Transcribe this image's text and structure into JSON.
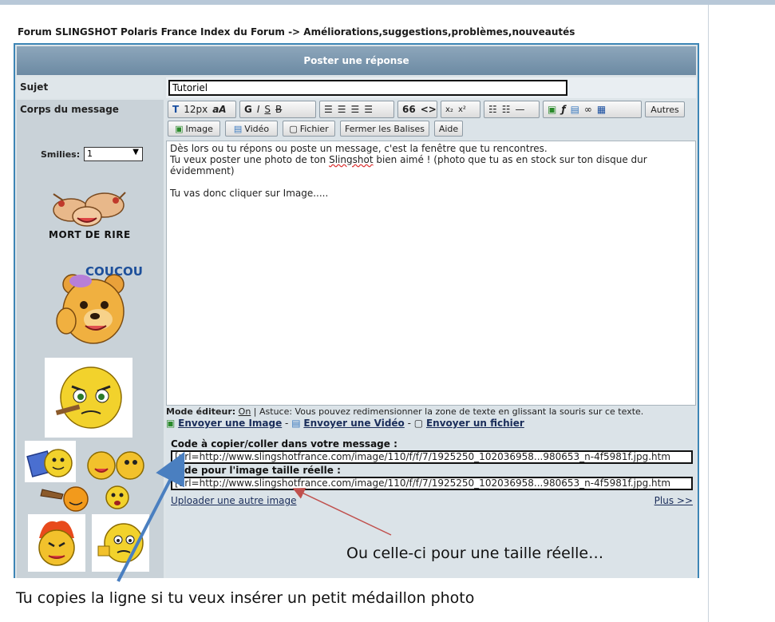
{
  "breadcrumb": "Forum SLINGSHOT Polaris France Index du Forum -> Améliorations,suggestions,problèmes,nouveautés",
  "form": {
    "header": "Poster une réponse",
    "subject_label": "Sujet",
    "subject_value": "Tutoriel",
    "body_label": "Corps du message",
    "smilies_label": "Smilies:",
    "smilies_value": "1"
  },
  "smileys": [
    {
      "name": "mort-de-rire",
      "caption": "MORT DE RIRE"
    },
    {
      "name": "coucou",
      "caption": "COUCOU"
    }
  ],
  "toolbar": {
    "font_size": "12px",
    "bold": "G",
    "italic": "I",
    "underline": "S",
    "strike": "B",
    "quote": "66",
    "code": "<>",
    "sub": "x₂",
    "sup": "x²",
    "autres": "Autres",
    "image": "Image",
    "video": "Vidéo",
    "fichier": "Fichier",
    "fermer": "Fermer les Balises",
    "aide": "Aide"
  },
  "message": {
    "line1": "Dès lors ou tu répons ou poste un message, c'est la fenêtre que tu rencontres.",
    "line2a": "Tu veux poster une photo de ton ",
    "line2b": "Slingshot",
    "line2c": " bien aimé ! (photo que tu as en stock sur ton disque dur",
    "line3": "évidemment)",
    "line4": "Tu vas donc cliquer sur Image....."
  },
  "editor": {
    "mode_label": "Mode éditeur:",
    "mode_value": "On",
    "tip": " | Astuce: Vous pouvez redimensionner la zone de texte en glissant la souris sur ce texte.",
    "send_image": "Envoyer une Image",
    "send_video": "Envoyer une Vidéo",
    "send_file": "Envoyer un fichier",
    "sep": " - ",
    "code_label": "Code à copier/coller dans votre message :",
    "code_value": "[url=http://www.slingshotfrance.com/image/110/f/f/7/1925250_102036958...980653_n-4f5981f.jpg.htm",
    "real_label": "Code pour l'image taille réelle :",
    "real_value": "[url=http://www.slingshotfrance.com/image/110/f/f/7/1925250_102036958...980653_n-4f5981f.jpg.htm",
    "upload_other": "Uploader une autre image",
    "plus": "Plus >>"
  },
  "annotations": {
    "right": "Ou celle-ci pour une taille réelle…",
    "bottom": "Tu copies la ligne si tu veux insérer un petit médaillon photo"
  },
  "colors": {
    "header_bg": "#7893aa",
    "border": "#3d85b5",
    "arrow_blue": "#4a7fc0",
    "arrow_red": "#c0504d"
  }
}
